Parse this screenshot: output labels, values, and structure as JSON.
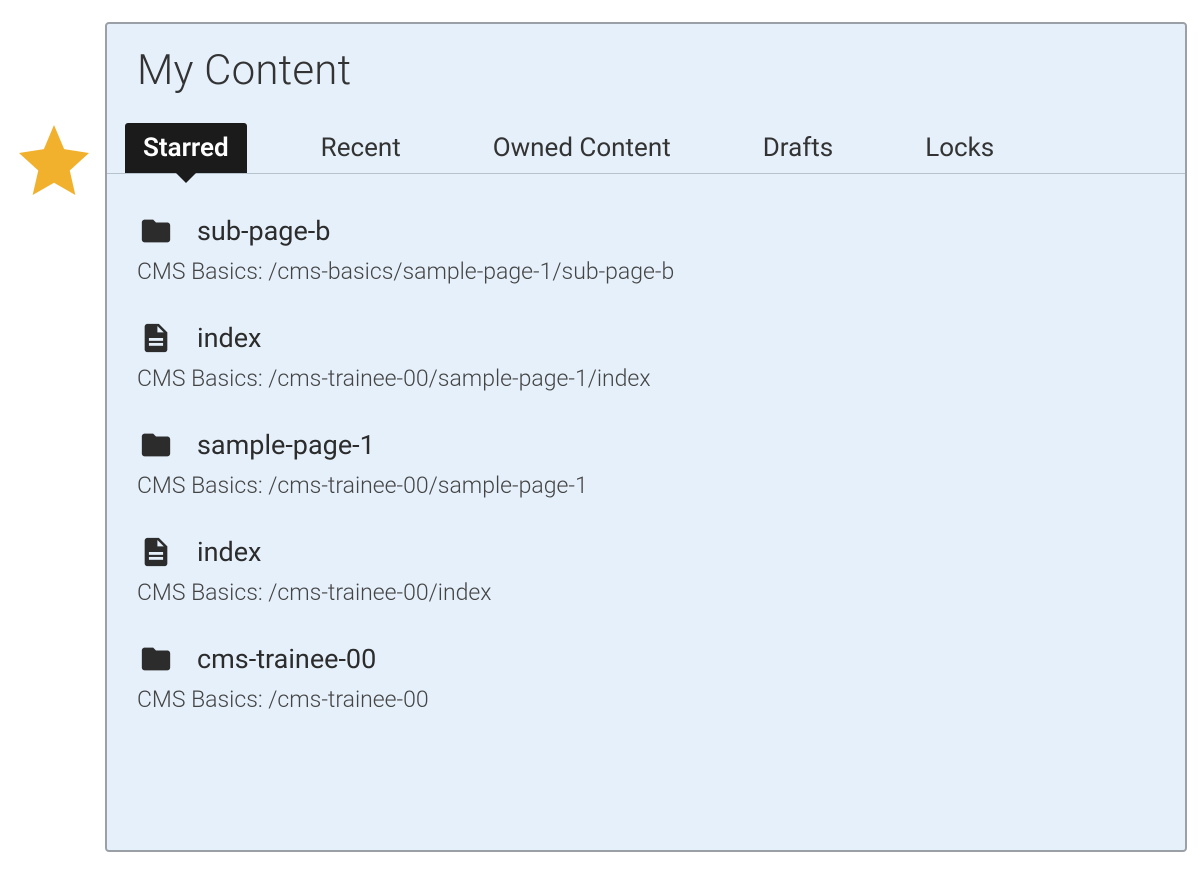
{
  "colors": {
    "panel_bg": "#e5f0fa",
    "panel_border": "#9aa0a6",
    "tab_active_bg": "#1b1b1b",
    "tab_active_fg": "#ffffff",
    "star_fill": "#f1b12c"
  },
  "header": {
    "title": "My Content"
  },
  "tabs": [
    {
      "label": "Starred",
      "active": true
    },
    {
      "label": "Recent",
      "active": false
    },
    {
      "label": "Owned Content",
      "active": false
    },
    {
      "label": "Drafts",
      "active": false
    },
    {
      "label": "Locks",
      "active": false
    }
  ],
  "items": [
    {
      "icon": "folder-icon",
      "title": "sub-page-b",
      "path": "CMS Basics: /cms-basics/sample-page-1/sub-page-b"
    },
    {
      "icon": "file-icon",
      "title": "index",
      "path": "CMS Basics: /cms-trainee-00/sample-page-1/index"
    },
    {
      "icon": "folder-icon",
      "title": "sample-page-1",
      "path": "CMS Basics: /cms-trainee-00/sample-page-1"
    },
    {
      "icon": "file-icon",
      "title": "index",
      "path": "CMS Basics: /cms-trainee-00/index"
    },
    {
      "icon": "folder-icon",
      "title": "cms-trainee-00",
      "path": "CMS Basics: /cms-trainee-00"
    }
  ]
}
